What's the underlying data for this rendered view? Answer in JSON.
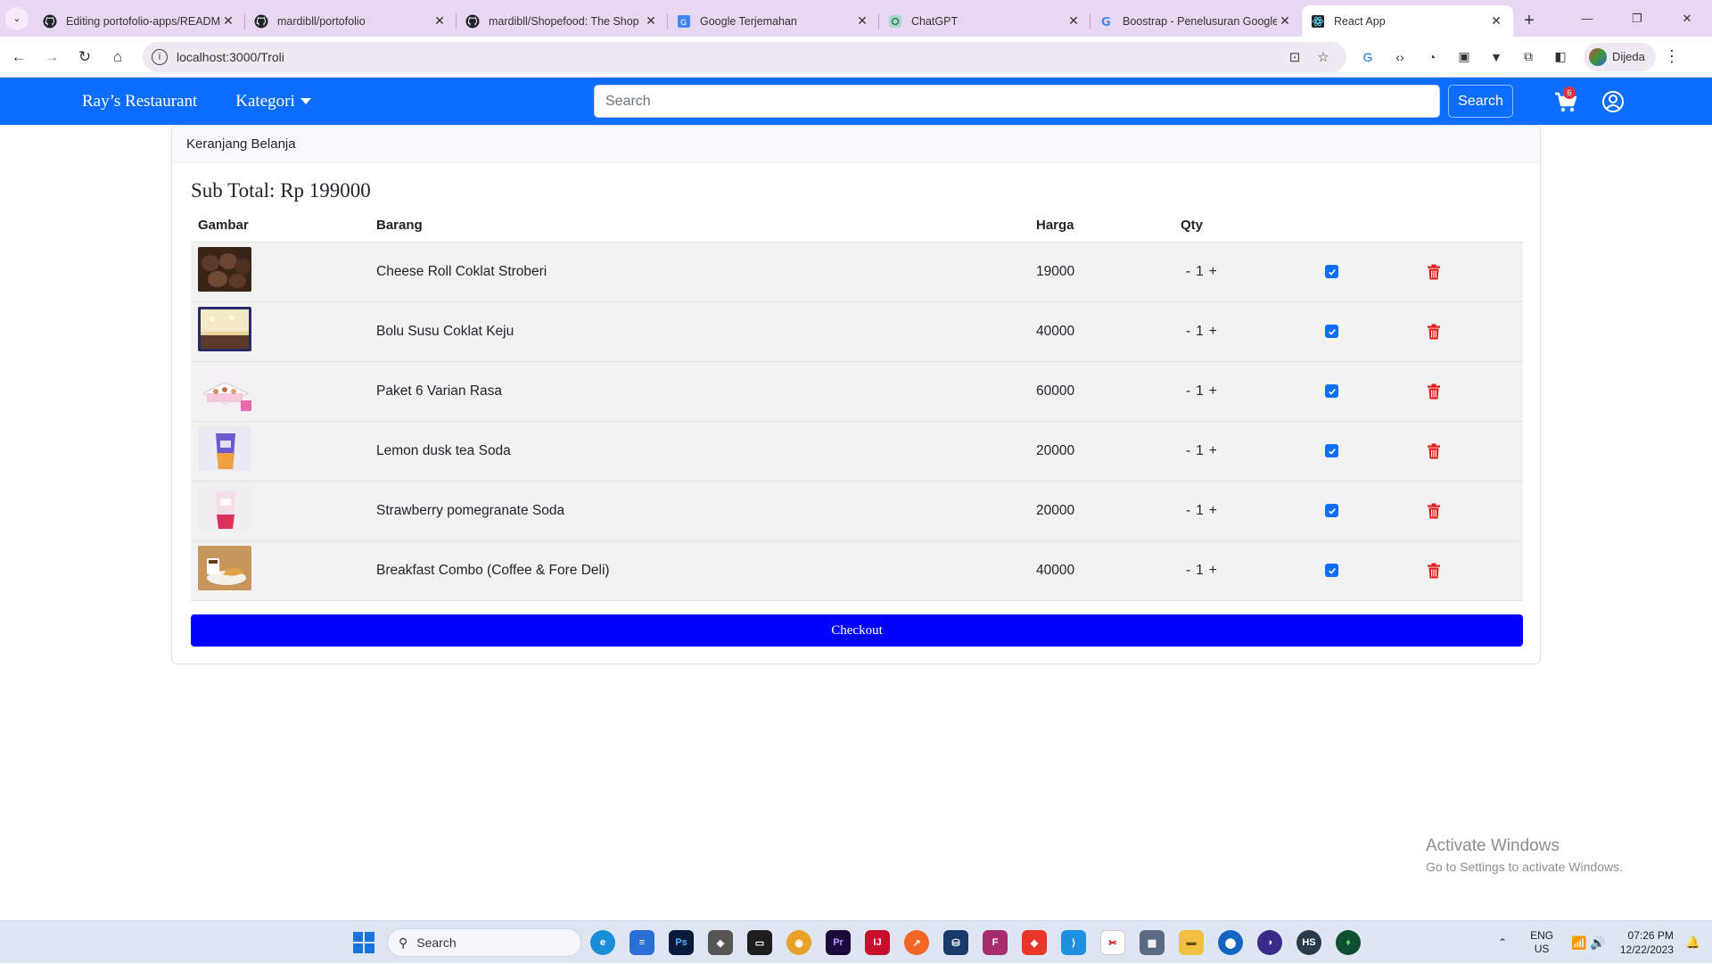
{
  "browser": {
    "tabs": [
      {
        "title": "Editing portofolio-apps/READM",
        "icon": "github-icon",
        "active": false
      },
      {
        "title": "mardibll/portofolio",
        "icon": "github-icon",
        "active": false
      },
      {
        "title": "mardibll/Shopefood: The Shop",
        "icon": "github-icon",
        "active": false
      },
      {
        "title": "Google Terjemahan",
        "icon": "translate-icon",
        "active": false
      },
      {
        "title": "ChatGPT",
        "icon": "chatgpt-icon",
        "active": false
      },
      {
        "title": "Boostrap - Penelusuran Google",
        "icon": "google-icon",
        "active": false
      },
      {
        "title": "React App",
        "icon": "react-icon",
        "active": true
      }
    ],
    "url": "localhost:3000/Troli",
    "profile_label": "Dijeda"
  },
  "navbar": {
    "brand": "Ray’s Restaurant",
    "kategori": "Kategori",
    "search_placeholder": "Search",
    "search_button": "Search",
    "cart_count": "6",
    "accent_color": "#0d6efd"
  },
  "cart": {
    "header": "Keranjang Belanja",
    "subtotal": "Sub Total: Rp 199000",
    "columns": [
      "Gambar",
      "Barang",
      "Harga",
      "Qty",
      "",
      ""
    ],
    "items": [
      {
        "name": "Cheese Roll Coklat Stroberi",
        "price": "19000",
        "qty": "1",
        "thumb": "brown-rolls"
      },
      {
        "name": "Bolu Susu Coklat Keju",
        "price": "40000",
        "qty": "1",
        "thumb": "cheese-cake"
      },
      {
        "name": "Paket 6 Varian Rasa",
        "price": "60000",
        "qty": "1",
        "thumb": "gift-box"
      },
      {
        "name": "Lemon dusk tea Soda",
        "price": "20000",
        "qty": "1",
        "thumb": "purple-drink"
      },
      {
        "name": "Strawberry pomegranate Soda",
        "price": "20000",
        "qty": "1",
        "thumb": "pink-drink"
      },
      {
        "name": "Breakfast Combo (Coffee & Fore Deli)",
        "price": "40000",
        "qty": "1",
        "thumb": "coffee-croissant"
      }
    ],
    "checkout_label": "Checkout",
    "checkout_color": "#0000ff"
  },
  "watermark": {
    "title": "Activate Windows",
    "subtitle": "Go to Settings to activate Windows."
  },
  "taskbar": {
    "search_label": "Search",
    "lang_top": "ENG",
    "lang_bottom": "US",
    "time": "07:26 PM",
    "date": "12/22/2023"
  }
}
